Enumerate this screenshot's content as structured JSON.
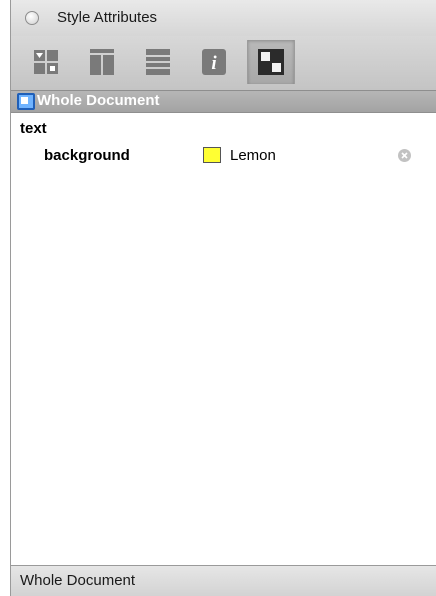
{
  "window": {
    "title": "Style Attributes"
  },
  "toolbar": {
    "tools": [
      {
        "icon": "style-sheet-icon"
      },
      {
        "icon": "columns-layout-icon"
      },
      {
        "icon": "rows-layout-icon"
      },
      {
        "icon": "info-icon"
      },
      {
        "icon": "whole-document-icon",
        "selected": true
      }
    ]
  },
  "scope": {
    "label": "Whole Document"
  },
  "sections": [
    {
      "label": "text",
      "attributes": [
        {
          "name": "background",
          "value": "Lemon",
          "swatch_color": "#ffff33"
        }
      ]
    }
  ],
  "status": {
    "text": "Whole Document"
  },
  "colors": {
    "header_bg": "#aaaaaa",
    "selection_blue": "#2f7fe0"
  }
}
